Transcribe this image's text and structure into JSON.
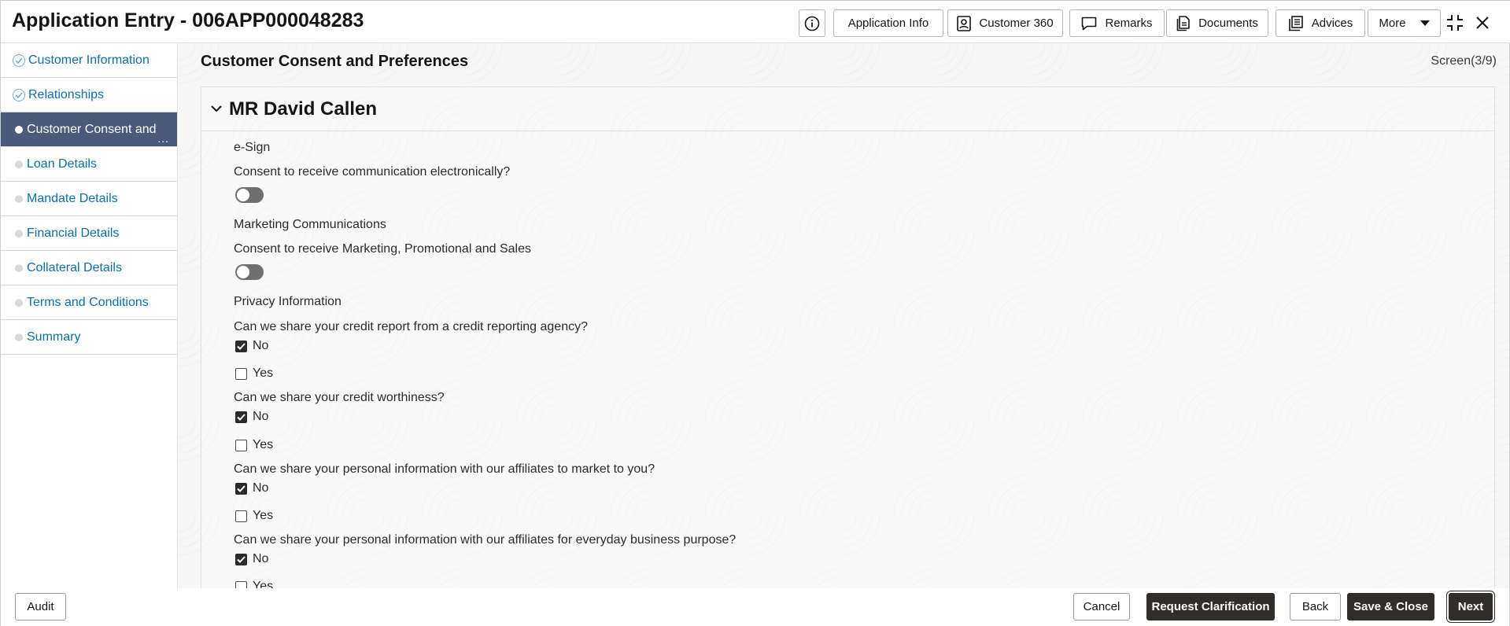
{
  "header": {
    "title": "Application Entry - 006APP000048283",
    "buttons": {
      "application_info": "Application Info",
      "customer_360": "Customer 360",
      "remarks": "Remarks",
      "documents": "Documents",
      "advices": "Advices",
      "more": "More"
    },
    "icons": [
      "info-icon",
      "customer-icon",
      "remarks-icon",
      "documents-icon",
      "advices-icon",
      "chevron-down-icon",
      "collapse-icon",
      "close-icon"
    ]
  },
  "sidebar": {
    "items": [
      {
        "label": "Customer Information",
        "state": "completed"
      },
      {
        "label": "Relationships",
        "state": "completed"
      },
      {
        "label": "Customer Consent and",
        "state": "active",
        "overflow": "..."
      },
      {
        "label": "Loan Details",
        "state": "pending"
      },
      {
        "label": "Mandate Details",
        "state": "pending"
      },
      {
        "label": "Financial Details",
        "state": "pending"
      },
      {
        "label": "Collateral Details",
        "state": "pending"
      },
      {
        "label": "Terms and Conditions",
        "state": "pending"
      },
      {
        "label": "Summary",
        "state": "pending"
      }
    ]
  },
  "main": {
    "title": "Customer Consent and Preferences",
    "screen": "Screen(3/9)",
    "customer_name": "MR David Callen",
    "esign": {
      "label": "e-Sign",
      "question": "Consent to receive communication electronically?",
      "enabled": false
    },
    "marketing": {
      "label": "Marketing Communications",
      "question": "Consent to receive Marketing, Promotional and Sales",
      "enabled": false
    },
    "privacy": {
      "label": "Privacy Information",
      "questions": [
        {
          "text": "Can we share your credit report from a credit reporting agency?",
          "options": [
            {
              "label": "No",
              "checked": true
            },
            {
              "label": "Yes",
              "checked": false
            }
          ]
        },
        {
          "text": "Can we share your credit worthiness?",
          "options": [
            {
              "label": "No",
              "checked": true
            },
            {
              "label": "Yes",
              "checked": false
            }
          ]
        },
        {
          "text": "Can we share your personal information with our affiliates to market to you?",
          "options": [
            {
              "label": "No",
              "checked": true
            },
            {
              "label": "Yes",
              "checked": false
            }
          ]
        },
        {
          "text": "Can we share your personal information with our affiliates for everyday business purpose?",
          "options": [
            {
              "label": "No",
              "checked": true
            },
            {
              "label": "Yes",
              "checked": false
            }
          ]
        }
      ]
    }
  },
  "footer": {
    "audit": "Audit",
    "cancel": "Cancel",
    "request_clarification": "Request Clarification",
    "back": "Back",
    "save_close": "Save & Close",
    "next": "Next"
  },
  "colors": {
    "active_step_bg": "#4b5a7a",
    "link": "#0b6fa8",
    "dark_button": "#312d2a"
  }
}
